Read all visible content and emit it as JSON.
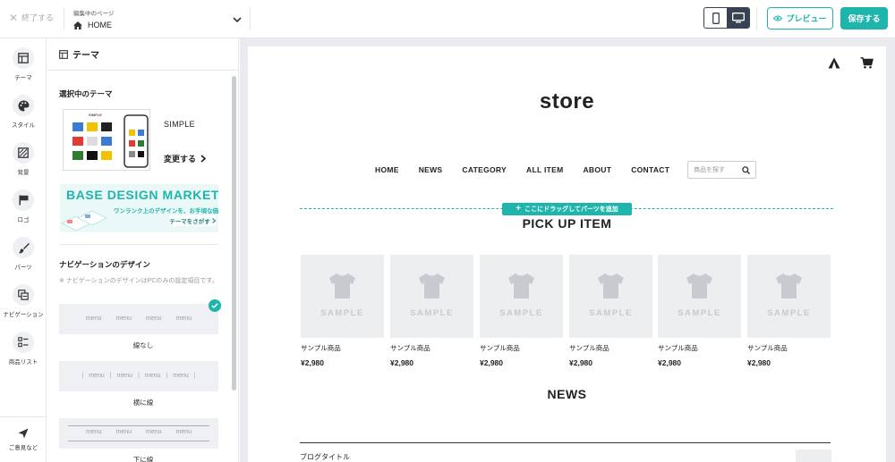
{
  "topbar": {
    "exit_label": "終了する",
    "page_caption": "編集中のページ",
    "page_name": "HOME",
    "preview_label": "プレビュー",
    "save_label": "保存する"
  },
  "rail": {
    "items": [
      {
        "label": "テーマ",
        "icon": "layout-icon"
      },
      {
        "label": "スタイル",
        "icon": "palette-icon"
      },
      {
        "label": "背景",
        "icon": "background-icon"
      },
      {
        "label": "ロゴ",
        "icon": "flag-icon"
      },
      {
        "label": "パーツ",
        "icon": "brush-icon"
      },
      {
        "label": "ナビゲーション",
        "icon": "navigation-icon"
      },
      {
        "label": "商品リスト",
        "icon": "list-icon"
      }
    ],
    "feedback_label": "ご意見など"
  },
  "panel": {
    "title": "テーマ",
    "selected_theme_heading": "選択中のテーマ",
    "theme_name": "SIMPLE",
    "change_label": "変更する",
    "banner": {
      "title": "BASE DESIGN MARKET",
      "subtitle": "ワンランク上のデザインを、お手頃な価格で",
      "link": "テーマをさがす"
    },
    "nav_design_heading": "ナビゲーションのデザイン",
    "nav_note": "※ ナビゲーションのデザインはPCのみの設定項目です。",
    "nav_options": [
      {
        "label": "線なし",
        "item": "menu"
      },
      {
        "label": "横に線",
        "item": "menu"
      },
      {
        "label": "下に線",
        "item": "menu"
      }
    ],
    "thumb_brand": "SIMPLE"
  },
  "store": {
    "brand": "store",
    "nav": [
      "HOME",
      "NEWS",
      "CATEGORY",
      "ALL ITEM",
      "ABOUT",
      "CONTACT"
    ],
    "search_placeholder": "商品を探す",
    "drop_label": "ここにドラッグしてパーツを追加",
    "pickup_heading": "PICK UP ITEM",
    "products": [
      {
        "name": "サンプル商品",
        "price": "¥2,980",
        "sample": "SAMPLE"
      },
      {
        "name": "サンプル商品",
        "price": "¥2,980",
        "sample": "SAMPLE"
      },
      {
        "name": "サンプル商品",
        "price": "¥2,980",
        "sample": "SAMPLE"
      },
      {
        "name": "サンプル商品",
        "price": "¥2,980",
        "sample": "SAMPLE"
      },
      {
        "name": "サンプル商品",
        "price": "¥2,980",
        "sample": "SAMPLE"
      },
      {
        "name": "サンプル商品",
        "price": "¥2,980",
        "sample": "SAMPLE"
      }
    ],
    "news_heading": "NEWS",
    "news_item": "ブログタイトル"
  },
  "colors": {
    "accent": "#1fb5ac",
    "dark": "#384253",
    "canvas_bg": "#e9ebef"
  }
}
